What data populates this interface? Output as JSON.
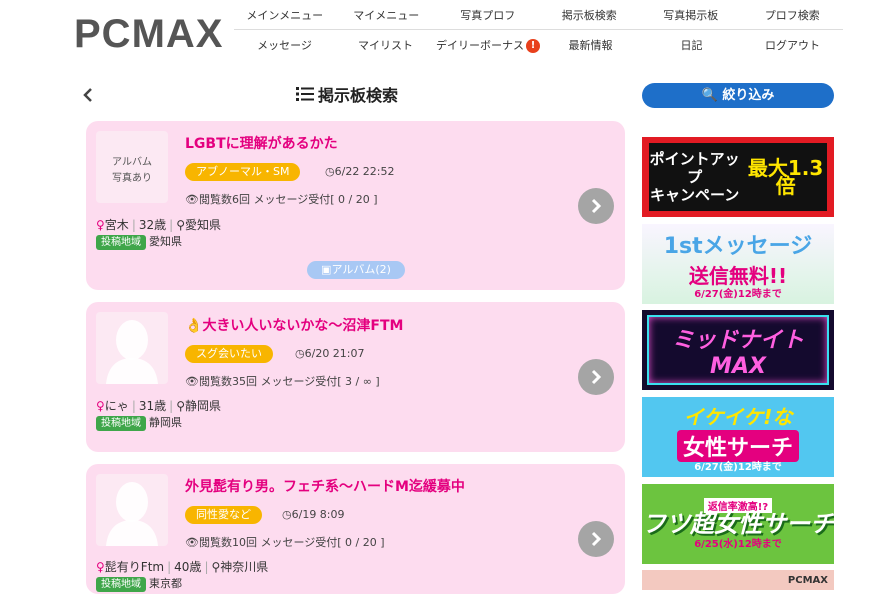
{
  "header": {
    "logo": "PCMAX",
    "nav_top": [
      "メインメニュー",
      "マイメニュー",
      "写真プロフ",
      "掲示板検索",
      "写真掲示板",
      "プロフ検索"
    ],
    "nav_bottom": [
      "メッセージ",
      "マイリスト",
      "デイリーボーナス",
      "最新情報",
      "日記",
      "ログアウト"
    ],
    "bonus_badge": "!"
  },
  "page": {
    "title": "掲示板検索"
  },
  "filter_button": "絞り込み",
  "posts": [
    {
      "thumb_text": "アルバム\n写真あり",
      "title": "LGBTに理解があるかた",
      "tag": "アブノーマル・SM",
      "date": "6/22 22:52",
      "stats": "閲覧数6回 メッセージ受付[ 0 / 20 ]",
      "name": "宮木",
      "age": "32歳",
      "location": "愛知県",
      "region_label": "投稿地域",
      "region": "愛知県",
      "album": "アルバム(2)"
    },
    {
      "title": "大きい人いないかな～沼津FTM",
      "tag": "スグ会いたい",
      "date": "6/20 21:07",
      "stats": "閲覧数35回 メッセージ受付[ 3 / ∞ ]",
      "name": "にゃ",
      "age": "31歳",
      "location": "静岡県",
      "region_label": "投稿地域",
      "region": "静岡県"
    },
    {
      "title": "外見髭有り男。フェチ系～ハードM迄緩募中",
      "tag": "同性愛など",
      "date": "6/19 8:09",
      "stats": "閲覧数10回 メッセージ受付[ 0 / 20 ]",
      "name": "髭有りFtm",
      "age": "40歳",
      "location": "神奈川県",
      "region_label": "投稿地域",
      "region": "東京都"
    }
  ],
  "banners": {
    "b1_line1": "ポイントアップ",
    "b1_line2": "キャンペーン",
    "b1_big": "最大1.3倍",
    "b2_t1": "1stメッセージ",
    "b2_t2": "送信無料!!",
    "b2_sub": "6/27(金)12時まで",
    "b3": "ミッドナイトMAX",
    "b4_t1": "イケイケ!な",
    "b4_t2": "女性サーチ",
    "b4_sub": "6/27(金)12時まで",
    "b5_s1": "返信率激高!?",
    "b5_t": "フツ超女性サーチ",
    "b5_s2": "6/25(水)12時まで",
    "b6": "PCMAX"
  },
  "colors": {
    "accent": "#e4007f",
    "card_bg": "#fddcef",
    "tag": "#f8b500",
    "button": "#1e6fc9",
    "region_chip": "#3fa64a"
  }
}
